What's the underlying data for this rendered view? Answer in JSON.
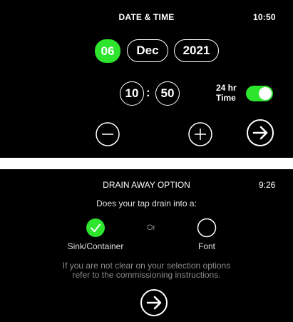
{
  "screen1": {
    "title": "DATE & TIME",
    "clock": "10:50",
    "date": {
      "day": "06",
      "month": "Dec",
      "year": "2021"
    },
    "time": {
      "hours": "10",
      "separator": ":",
      "minutes": "50"
    },
    "format_toggle": {
      "label_line1": "24 hr",
      "label_line2": "Time",
      "on": true
    },
    "icons": {
      "decrement": "minus-circle-icon",
      "increment": "plus-circle-icon",
      "next": "arrow-right-circle-icon"
    },
    "colors": {
      "accent": "#2ee52e",
      "background": "#000000"
    }
  },
  "screen2": {
    "title": "DRAIN AWAY OPTION",
    "clock": "9:26",
    "question": "Does your tap drain into a:",
    "separator": "Or",
    "options": [
      {
        "label": "Sink/Container",
        "selected": true
      },
      {
        "label": "Font",
        "selected": false
      }
    ],
    "help_line1": "If you are not clear on your selection options",
    "help_line2": "refer to the commissioning instructions.",
    "icons": {
      "selected": "check-circle-icon",
      "next": "arrow-right-circle-icon"
    }
  }
}
